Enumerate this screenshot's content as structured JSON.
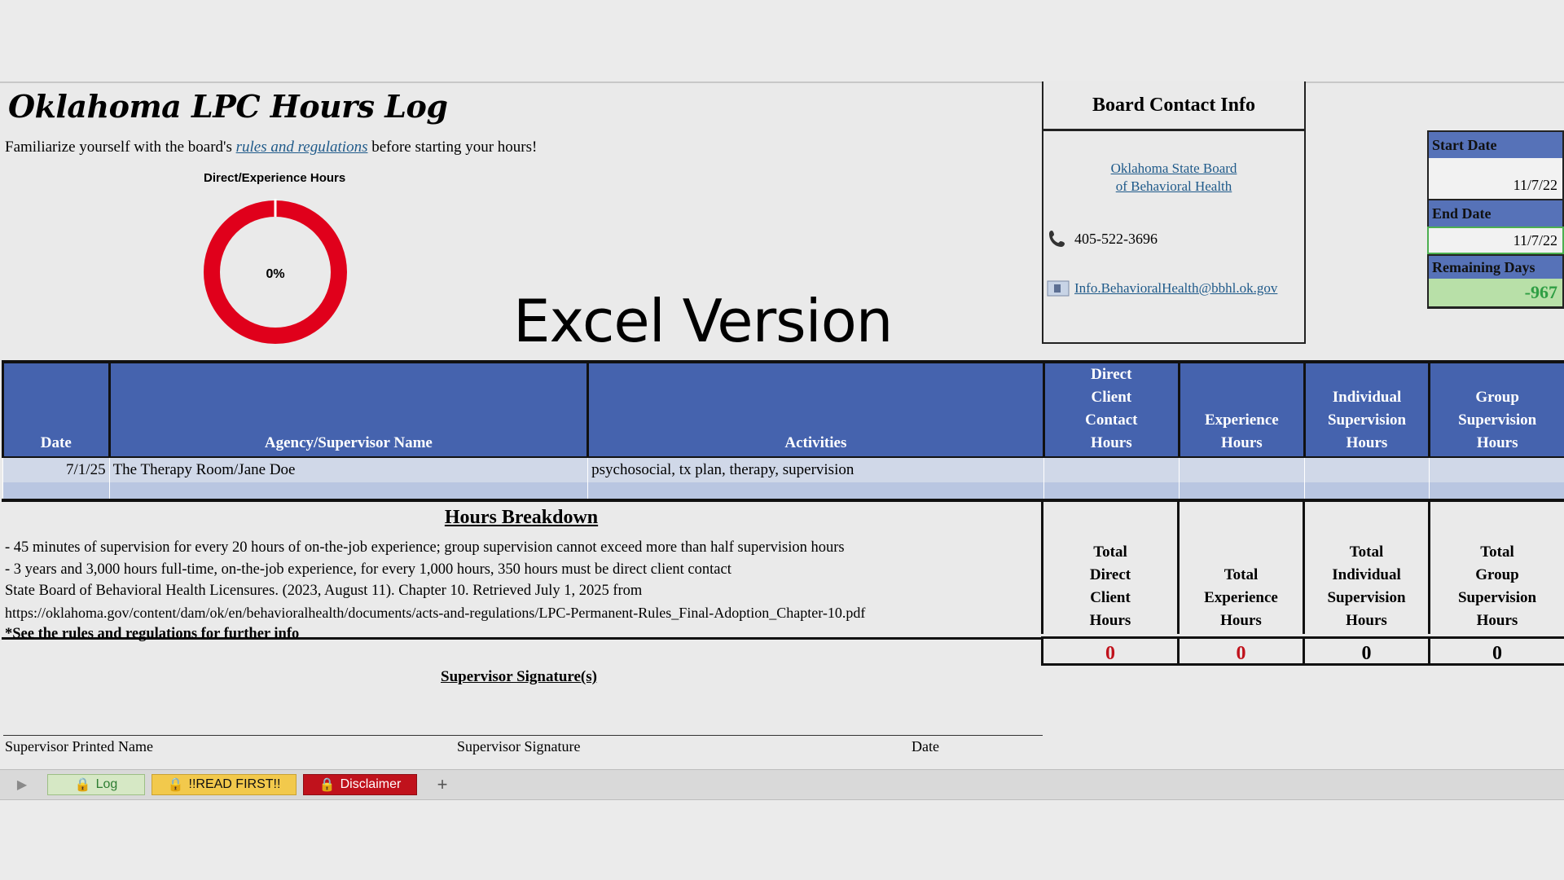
{
  "header": {
    "title": "Oklahoma LPC Hours Log",
    "intro_before": "Familiarize yourself with the board's ",
    "intro_link": "rules and regulations",
    "intro_after": " before starting your hours!",
    "version_label": "Excel Version"
  },
  "chart_data": {
    "type": "pie",
    "title": "Direct/Experience Hours",
    "center_label": "0%",
    "percent_complete": 0,
    "ring_color": "#e0001b"
  },
  "board": {
    "heading": "Board Contact Info",
    "link_line1": "Oklahoma State Board",
    "link_line2": "of Behavioral Health",
    "phone": "405-522-3696",
    "email": "Info.BehavioralHealth@bbhl.ok.gov",
    "phone_icon": "phone-icon",
    "email_icon": "email-icon"
  },
  "dates": {
    "start_label": "Start Date",
    "start_value": "11/7/22",
    "end_label": "End Date",
    "end_value": "11/7/22",
    "remaining_label": "Remaining Days",
    "remaining_value": "-967"
  },
  "table": {
    "headers": {
      "date": "Date",
      "agency": "Agency/Supervisor Name",
      "activities": "Activities",
      "direct_l1": "Direct",
      "direct_l2": "Client",
      "direct_l3": "Contact",
      "direct_l4": "Hours",
      "experience_l1": "Experience",
      "experience_l2": "Hours",
      "individual_l1": "Individual",
      "individual_l2": "Supervision",
      "individual_l3": "Hours",
      "group_l1": "Group",
      "group_l2": "Supervision",
      "group_l3": "Hours"
    },
    "rows": [
      {
        "date": "7/1/25",
        "agency": "The Therapy Room/Jane Doe",
        "activities": "psychosocial, tx plan, therapy, supervision",
        "direct": "",
        "experience": "",
        "individual": "",
        "group": ""
      }
    ]
  },
  "breakdown": {
    "title": "Hours Breakdown",
    "line1": "- 45 minutes of supervision for every 20 hours of on-the-job experience; group supervision cannot exceed more than half supervision hours",
    "line2": "- 3 years and 3,000 hours full-time, on-the-job experience, for every 1,000 hours, 350 hours must be direct client contact",
    "line3": "State Board of Behavioral Health Licensures. (2023, August 11). Chapter 10. Retrieved July 1, 2025 from",
    "line4": "https://oklahoma.gov/content/dam/ok/en/behavioralhealth/documents/acts-and-regulations/LPC-Permanent-Rules_Final-Adoption_Chapter-10.pdf",
    "line5": "*See the rules and regulations for further info"
  },
  "totals": {
    "direct_l1": "Total",
    "direct_l2": "Direct",
    "direct_l3": "Client",
    "direct_l4": "Hours",
    "experience_l1": "Total",
    "experience_l2": "Experience",
    "experience_l3": "Hours",
    "individual_l1": "Total",
    "individual_l2": "Individual",
    "individual_l3": "Supervision",
    "individual_l4": "Hours",
    "group_l1": "Total",
    "group_l2": "Group",
    "group_l3": "Supervision",
    "group_l4": "Hours",
    "direct_value": "0",
    "experience_value": "0",
    "individual_value": "0",
    "group_value": "0"
  },
  "signature": {
    "title": "Supervisor Signature(s)",
    "printed_name": "Supervisor Printed Name",
    "signature": "Supervisor Signature",
    "date": "Date"
  },
  "tabs": [
    {
      "label": "Log",
      "icon": "lock-icon",
      "color": "#d6e8c5",
      "text_color": "#2e7d32"
    },
    {
      "label": "!!READ FIRST!!",
      "icon": "lock-icon",
      "color": "#f2c94c",
      "text_color": "#111111"
    },
    {
      "label": "Disclaimer",
      "icon": "lock-icon",
      "color": "#c0121c",
      "text_color": "#ffffff"
    }
  ],
  "add_sheet": "+",
  "colors": {
    "header_blue": "#4563ae",
    "row_light": "#d0d8e8",
    "row_mid": "#b9c6e1",
    "remaining_green": "#2f9e44",
    "remaining_bg": "#b8e0a8",
    "zero_red": "#c0121c"
  }
}
